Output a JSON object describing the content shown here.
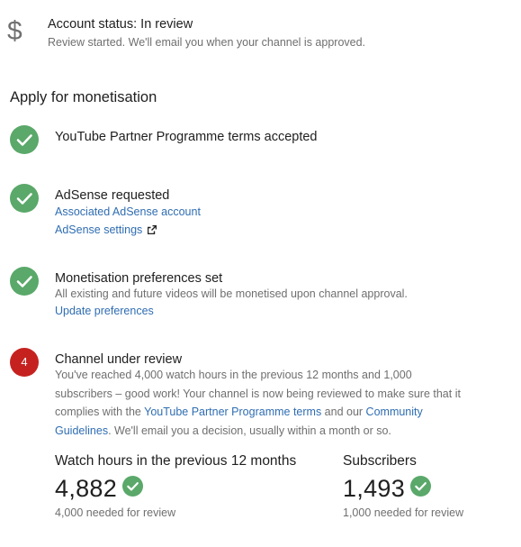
{
  "account_status": {
    "icon": "dollar-icon",
    "icon_glyph": "$",
    "title": "Account status: In review",
    "subtitle": "Review started. We'll email you when your channel is approved."
  },
  "section_heading": "Apply for monetisation",
  "steps": [
    {
      "state": "done",
      "title": "YouTube Partner Programme terms accepted"
    },
    {
      "state": "done",
      "title": "AdSense requested",
      "links": [
        "Associated AdSense account",
        "AdSense settings"
      ]
    },
    {
      "state": "done",
      "title": "Monetisation preferences set",
      "text": "All existing and future videos will be monetised upon channel approval.",
      "link": "Update preferences"
    },
    {
      "state": "alert",
      "badge": "4",
      "title": "Channel under review",
      "text_line1": "You've reached 4,000 watch hours in the previous 12 months and 1,000",
      "text_line2": "subscribers – good work! Your channel is now being reviewed to make sure that it",
      "text_line3_pre": "complies with the ",
      "text_line3_link1": "YouTube Partner Programme terms",
      "text_line3_mid": " and our ",
      "text_line3_link2": "Community",
      "text_line4_link2": "Guidelines",
      "text_line4_post": ". We'll email you a decision, usually within a month or so."
    }
  ],
  "stats": [
    {
      "label": "Watch hours in the previous 12 months",
      "value": "4,882",
      "note": "4,000 needed for review"
    },
    {
      "label": "Subscribers",
      "value": "1,493",
      "note": "1,000 needed for review"
    }
  ],
  "colors": {
    "check_green": "#5aa86a",
    "alert_red": "#c5221f",
    "link_blue": "#2f6db2"
  }
}
